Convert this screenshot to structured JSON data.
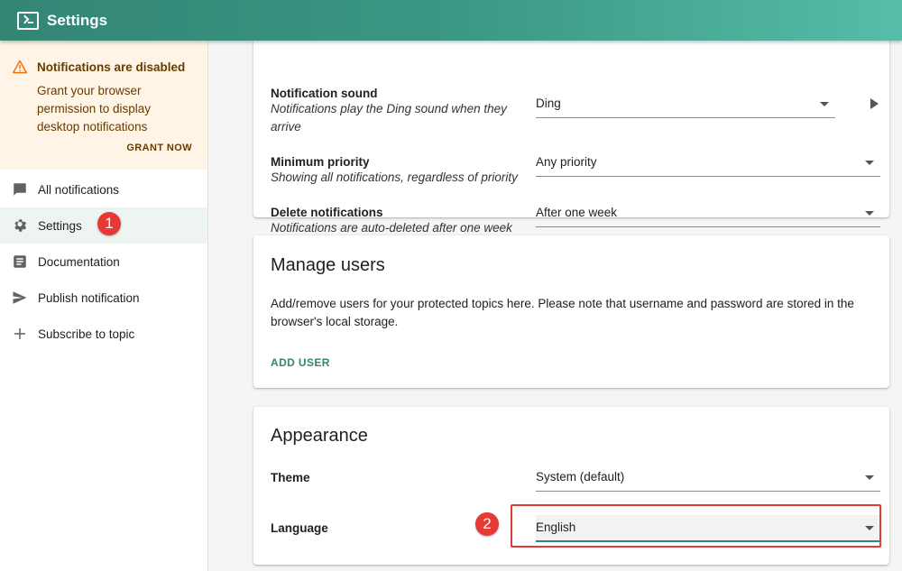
{
  "app": {
    "title": "Settings",
    "logo_icon": "terminal-icon",
    "accent": "#338574"
  },
  "sidebar": {
    "alert": {
      "title": "Notifications are disabled",
      "body": "Grant your browser permission to display desktop notifications",
      "action": "GRANT NOW",
      "icon": "warning-icon"
    },
    "items": [
      {
        "label": "All notifications",
        "icon": "chat-icon"
      },
      {
        "label": "Settings",
        "icon": "gear-icon"
      },
      {
        "label": "Documentation",
        "icon": "document-icon"
      },
      {
        "label": "Publish notification",
        "icon": "send-icon"
      },
      {
        "label": "Subscribe to topic",
        "icon": "plus-icon"
      }
    ]
  },
  "annotations": {
    "step1": "1",
    "step2": "2"
  },
  "notifications_card": {
    "sound": {
      "label": "Notification sound",
      "desc": "Notifications play the Ding sound when they arrive",
      "value": "Ding"
    },
    "priority": {
      "label": "Minimum priority",
      "desc": "Showing all notifications, regardless of priority",
      "value": "Any priority"
    },
    "delete": {
      "label": "Delete notifications",
      "desc": "Notifications are auto-deleted after one week",
      "value": "After one week"
    }
  },
  "users_card": {
    "title": "Manage users",
    "text": "Add/remove users for your protected topics here. Please note that username and password are stored in the browser's local storage.",
    "add_user": "ADD USER"
  },
  "appearance_card": {
    "title": "Appearance",
    "theme": {
      "label": "Theme",
      "value": "System (default)"
    },
    "language": {
      "label": "Language",
      "value": "English"
    }
  }
}
